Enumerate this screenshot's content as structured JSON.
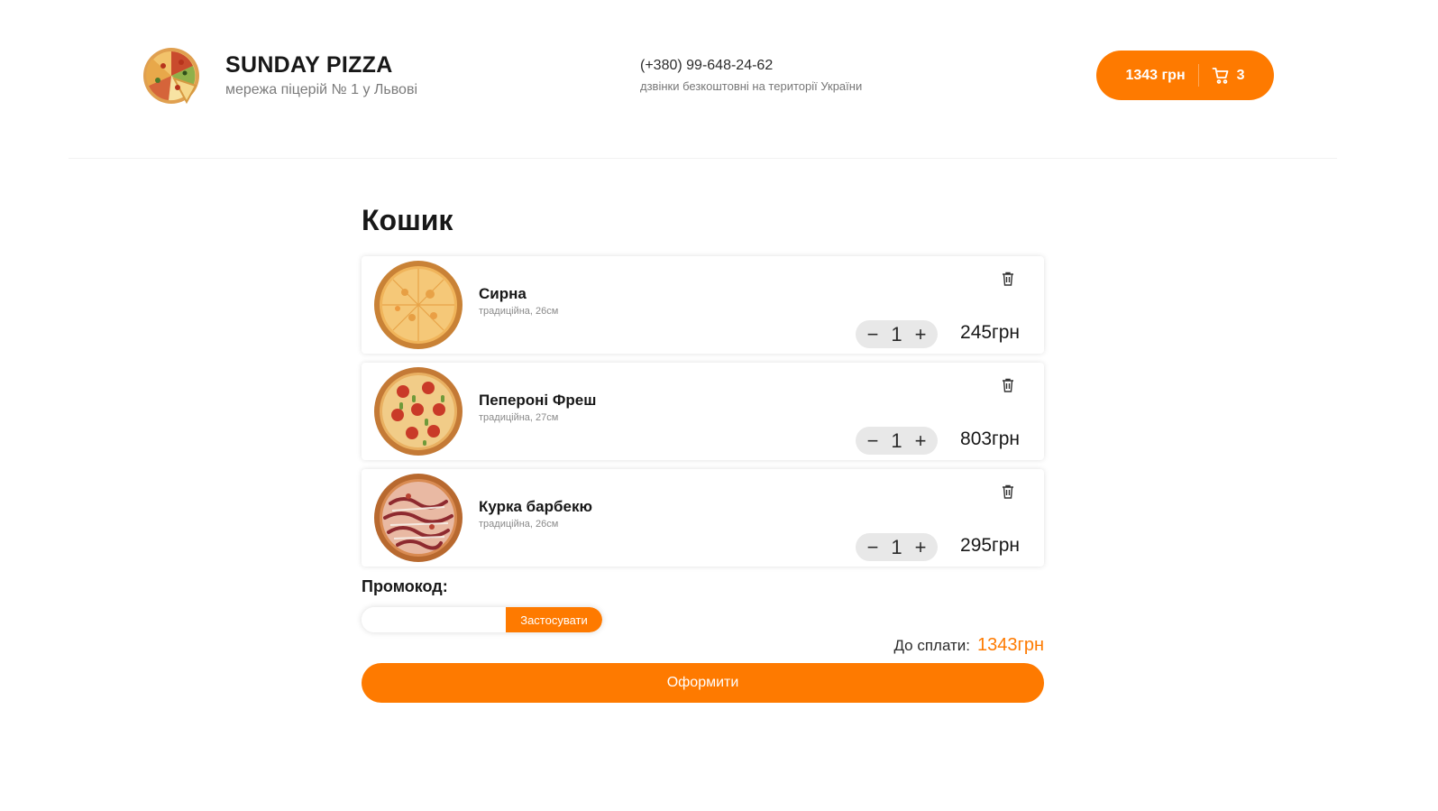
{
  "header": {
    "brand_title": "SUNDAY PIZZA",
    "brand_subtitle": "мережа піцерій № 1 у Львові",
    "phone": "(+380) 99-648-24-62",
    "phone_note": "дзвінки безкоштовні на території України",
    "cart_total": "1343 грн",
    "cart_count": "3",
    "accent_color": "#fe7a00"
  },
  "cart": {
    "title": "Кошик",
    "items": [
      {
        "name": "Сирна",
        "details": "традиційна, 26см",
        "quantity": "1",
        "price": "245грн",
        "image_icon": "cheese-pizza-image"
      },
      {
        "name": "Пепероні Фреш",
        "details": "традиційна, 27см",
        "quantity": "1",
        "price": "803грн",
        "image_icon": "pepperoni-pizza-image"
      },
      {
        "name": "Курка барбекю",
        "details": "традиційна, 26см",
        "quantity": "1",
        "price": "295грн",
        "image_icon": "bbq-chicken-pizza-image"
      }
    ],
    "decrement_symbol": "−",
    "increment_symbol": "+"
  },
  "promo": {
    "label": "Промокод:",
    "input_value": "",
    "apply_label": "Застосувати"
  },
  "summary": {
    "total_label": "До сплати:",
    "total_value": "1343грн",
    "checkout_label": "Оформити"
  }
}
